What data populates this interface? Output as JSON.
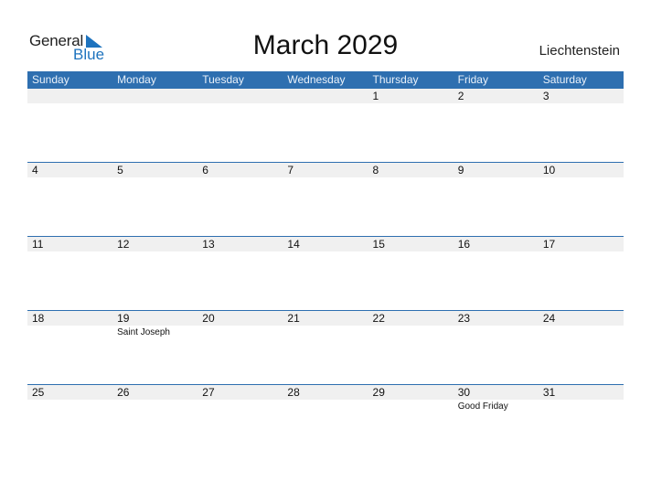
{
  "logo": {
    "line1": "General",
    "line2": "Blue",
    "brand_color": "#1e73be"
  },
  "title": "March 2029",
  "country": "Liechtenstein",
  "header_color": "#2e6fb0",
  "weekdays": [
    "Sunday",
    "Monday",
    "Tuesday",
    "Wednesday",
    "Thursday",
    "Friday",
    "Saturday"
  ],
  "weeks": [
    [
      {
        "day": ""
      },
      {
        "day": ""
      },
      {
        "day": ""
      },
      {
        "day": ""
      },
      {
        "day": "1"
      },
      {
        "day": "2"
      },
      {
        "day": "3"
      }
    ],
    [
      {
        "day": "4"
      },
      {
        "day": "5"
      },
      {
        "day": "6"
      },
      {
        "day": "7"
      },
      {
        "day": "8"
      },
      {
        "day": "9"
      },
      {
        "day": "10"
      }
    ],
    [
      {
        "day": "11"
      },
      {
        "day": "12"
      },
      {
        "day": "13"
      },
      {
        "day": "14"
      },
      {
        "day": "15"
      },
      {
        "day": "16"
      },
      {
        "day": "17"
      }
    ],
    [
      {
        "day": "18"
      },
      {
        "day": "19",
        "event": "Saint Joseph"
      },
      {
        "day": "20"
      },
      {
        "day": "21"
      },
      {
        "day": "22"
      },
      {
        "day": "23"
      },
      {
        "day": "24"
      }
    ],
    [
      {
        "day": "25"
      },
      {
        "day": "26"
      },
      {
        "day": "27"
      },
      {
        "day": "28"
      },
      {
        "day": "29"
      },
      {
        "day": "30",
        "event": "Good Friday"
      },
      {
        "day": "31"
      }
    ]
  ]
}
